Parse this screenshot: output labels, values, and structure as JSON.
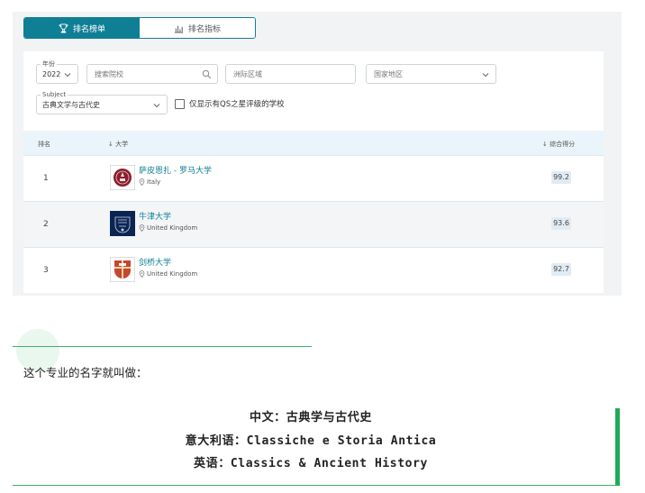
{
  "tabs": [
    {
      "label": "排名榜单",
      "active": true,
      "icon": "trophy-icon"
    },
    {
      "label": "排名指标",
      "active": false,
      "icon": "bar-chart-icon"
    }
  ],
  "filters": {
    "year": {
      "legend": "年份",
      "value": "2022"
    },
    "search": {
      "placeholder": "搜索院校"
    },
    "region": {
      "placeholder": "洲际区域"
    },
    "country": {
      "placeholder": "国家地区"
    },
    "subject": {
      "legend": "Subject",
      "value": "古典文学与古代史"
    },
    "qs_stars_checkbox": {
      "label": "仅显示有QS之星评级的学校",
      "checked": false
    }
  },
  "table": {
    "headers": {
      "rank": "排名",
      "university": "大学",
      "score": "综合得分"
    },
    "rows": [
      {
        "rank": "1",
        "name": "萨皮恩扎 - 罗马大学",
        "location": "Italy",
        "score": "99.2"
      },
      {
        "rank": "2",
        "name": "牛津大学",
        "location": "United Kingdom",
        "score": "93.6"
      },
      {
        "rank": "3",
        "name": "剑桥大学",
        "location": "United Kingdom",
        "score": "92.7"
      }
    ]
  },
  "article": {
    "intro": "这个专业的名字就叫做：",
    "lines": [
      "中文：古典学与古代史",
      "意大利语：Classiche e Storia Antica",
      "英语：Classics & Ancient History"
    ]
  },
  "colors": {
    "accent": "#0f7f95",
    "green": "#1faa59"
  }
}
